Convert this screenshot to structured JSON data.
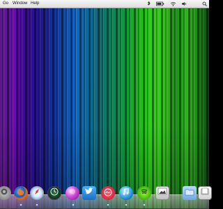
{
  "menubar": {
    "items": [
      "Go",
      "Window",
      "Help"
    ],
    "status_icons": [
      "bluetooth-icon",
      "battery-icon",
      "wifi-icon",
      "volume-icon",
      "spotlight-icon"
    ]
  },
  "dock": {
    "apps": [
      {
        "name": "system-preferences",
        "icon": "gear-icon"
      },
      {
        "name": "firefox",
        "icon": "firefox-icon"
      },
      {
        "name": "safari",
        "icon": "compass-icon"
      },
      {
        "name": "time-machine",
        "icon": "clock-icon"
      },
      {
        "name": "itunes-like",
        "icon": "orb-icon"
      },
      {
        "name": "twitter",
        "icon": "bird-icon"
      },
      {
        "name": "lastfm",
        "icon": "lastfm-icon"
      },
      {
        "name": "itunes",
        "icon": "music-note-icon"
      },
      {
        "name": "spotify",
        "icon": "spotify-icon"
      },
      {
        "name": "preview",
        "icon": "photo-icon"
      },
      {
        "name": "folder",
        "icon": "folder-icon"
      },
      {
        "name": "downloads-stack",
        "icon": "stack-icon"
      }
    ]
  },
  "colors": {
    "menubar": "#e6e6e6",
    "wallpaper_purple": "#6a0fb0",
    "wallpaper_blue": "#1167c4",
    "wallpaper_green": "#2dd11a"
  }
}
